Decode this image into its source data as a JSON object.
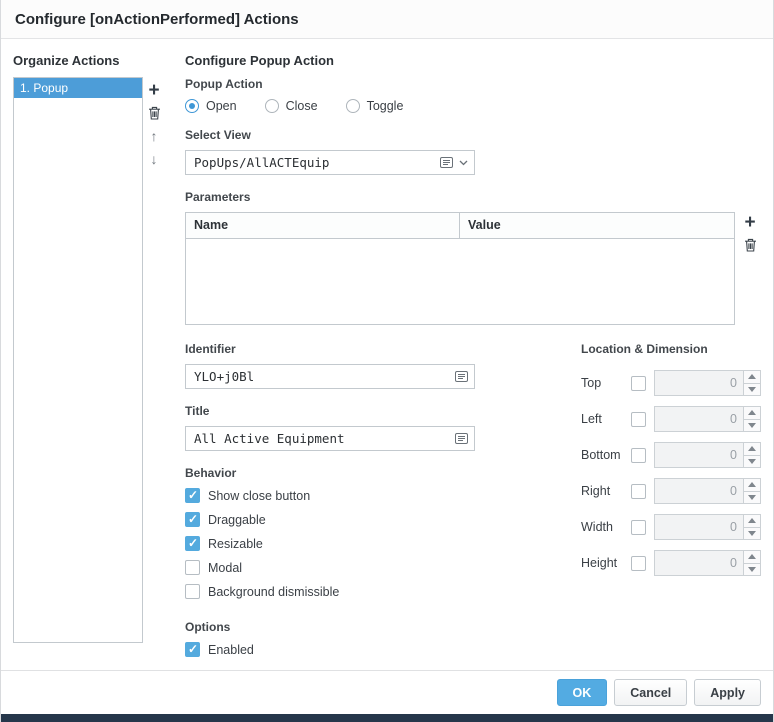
{
  "header": {
    "title": "Configure [onActionPerformed] Actions"
  },
  "organize": {
    "title": "Organize Actions",
    "items": [
      {
        "label": "1. Popup",
        "selected": true
      }
    ],
    "toolbar": {
      "add": "add",
      "delete": "delete",
      "move_up": "move up",
      "move_down": "move down"
    }
  },
  "configure": {
    "title": "Configure Popup Action",
    "popup_action": {
      "label": "Popup Action",
      "options": [
        {
          "label": "Open",
          "selected": true
        },
        {
          "label": "Close",
          "selected": false
        },
        {
          "label": "Toggle",
          "selected": false
        }
      ]
    },
    "select_view": {
      "label": "Select View",
      "value": "PopUps/AllACTEquip"
    },
    "parameters": {
      "label": "Parameters",
      "columns": [
        "Name",
        "Value"
      ],
      "rows": []
    },
    "identifier": {
      "label": "Identifier",
      "value": "YLO+j0Bl"
    },
    "title_field": {
      "label": "Title",
      "value": "All Active Equipment"
    },
    "behavior": {
      "label": "Behavior",
      "checkboxes": [
        {
          "label": "Show close button",
          "checked": true
        },
        {
          "label": "Draggable",
          "checked": true
        },
        {
          "label": "Resizable",
          "checked": true
        },
        {
          "label": "Modal",
          "checked": false
        },
        {
          "label": "Background dismissible",
          "checked": false
        }
      ]
    },
    "options": {
      "label": "Options",
      "checkboxes": [
        {
          "label": "Enabled",
          "checked": true
        }
      ]
    },
    "location": {
      "label": "Location & Dimension",
      "fields": [
        {
          "label": "Top",
          "value": "0",
          "checked": false
        },
        {
          "label": "Left",
          "value": "0",
          "checked": false
        },
        {
          "label": "Bottom",
          "value": "0",
          "checked": false
        },
        {
          "label": "Right",
          "value": "0",
          "checked": false
        },
        {
          "label": "Width",
          "value": "0",
          "checked": false
        },
        {
          "label": "Height",
          "value": "0",
          "checked": false
        }
      ]
    }
  },
  "footer": {
    "ok": "OK",
    "cancel": "Cancel",
    "apply": "Apply"
  },
  "colors": {
    "accent": "#54aade",
    "selected_item": "#4d9dd8",
    "ok_button": "#53abe2",
    "bottom_bar": "#26374b"
  }
}
